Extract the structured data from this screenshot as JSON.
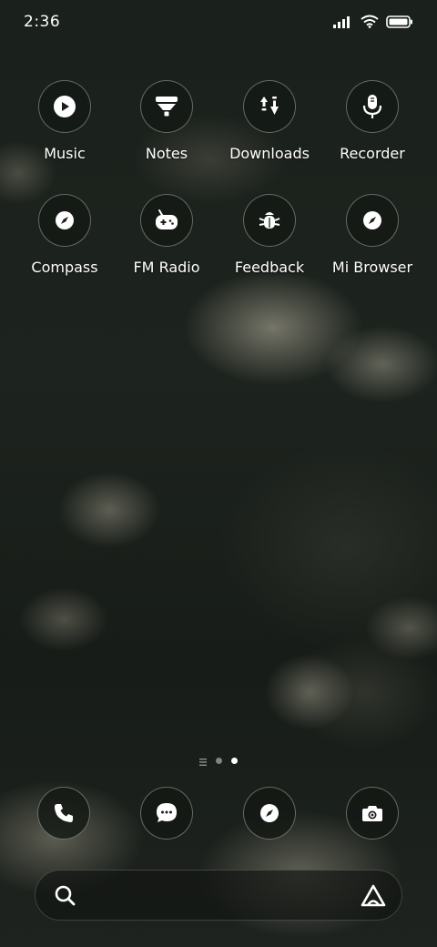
{
  "status_bar": {
    "time": "2:36",
    "icons": [
      "signal-icon",
      "wifi-icon",
      "battery-icon"
    ]
  },
  "apps": [
    {
      "label": "Music",
      "icon": "play-icon"
    },
    {
      "label": "Notes",
      "icon": "notes-funnel-icon"
    },
    {
      "label": "Downloads",
      "icon": "download-arrows-icon"
    },
    {
      "label": "Recorder",
      "icon": "microphone-icon"
    },
    {
      "label": "Compass",
      "icon": "compass-icon"
    },
    {
      "label": "FM Radio",
      "icon": "radio-gamepad-icon"
    },
    {
      "label": "Feedback",
      "icon": "bug-icon"
    },
    {
      "label": "Mi Browser",
      "icon": "compass-icon"
    }
  ],
  "page_indicator": {
    "pages": 3,
    "active_index": 2
  },
  "dock": [
    {
      "icon": "phone-icon"
    },
    {
      "icon": "message-icon"
    },
    {
      "icon": "compass-icon"
    },
    {
      "icon": "camera-icon"
    }
  ],
  "search_bar": {
    "left_icon": "search-icon",
    "right_icon": "assistant-icon"
  },
  "colors": {
    "icon_background": "#14181480",
    "text": "#ffffff"
  }
}
